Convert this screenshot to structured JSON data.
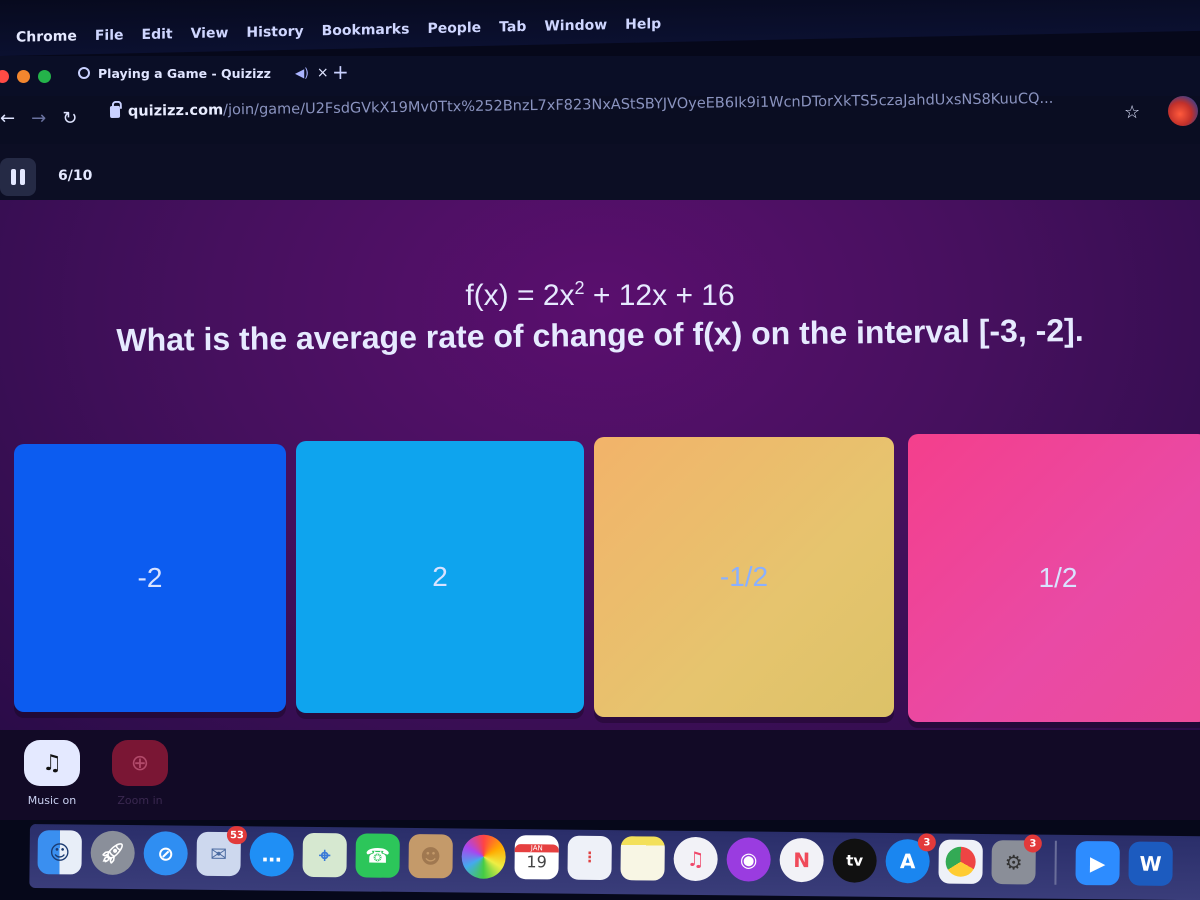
{
  "menubar": {
    "app_name": "Chrome",
    "items": [
      "File",
      "Edit",
      "View",
      "History",
      "Bookmarks",
      "People",
      "Tab",
      "Window",
      "Help"
    ]
  },
  "browser": {
    "tab": {
      "title": "Playing a Game - Quizizz",
      "audio_icon": "speaker-icon",
      "close_label": "×"
    },
    "new_tab_label": "+",
    "url_host": "quizizz.com",
    "url_path": "/join/game/U2FsdGVkX19Mv0Ttx%252BnzL7xF823NxAStSBYJVOyeEB6Ik9i1WcnDTorXkTS5czaJahdUxsNS8KuuCQ...",
    "colors": {
      "close": "#ff5f57",
      "minimize": "#febc2e",
      "zoom": "#28c840"
    }
  },
  "quiz": {
    "progress": "6/10",
    "question": {
      "formula_prefix": "f(x) = 2x",
      "formula_exp": "2",
      "formula_suffix": " + 12x + 16",
      "prompt": "What is the average rate of change of f(x) on the interval [-3, -2]."
    },
    "options": [
      {
        "label": "-2",
        "color": "#0c5cf0"
      },
      {
        "label": "2",
        "color": "#0ea4ee"
      },
      {
        "label": "-1/2",
        "color": "#f2b36a"
      },
      {
        "label": "1/2",
        "color": "#f43f8c"
      }
    ],
    "controls": {
      "music_label": "Music on",
      "zoom_label": "Zoom in"
    }
  },
  "dock": {
    "items": [
      {
        "name": "Finder"
      },
      {
        "name": "Launchpad"
      },
      {
        "name": "Safari"
      },
      {
        "name": "Mail",
        "badge": "53"
      },
      {
        "name": "Messages"
      },
      {
        "name": "Maps"
      },
      {
        "name": "FaceTime"
      },
      {
        "name": "Contacts"
      },
      {
        "name": "Photos"
      },
      {
        "name": "Calendar",
        "month": "JAN",
        "day": "19"
      },
      {
        "name": "Reminders"
      },
      {
        "name": "Notes"
      },
      {
        "name": "Music"
      },
      {
        "name": "Podcasts"
      },
      {
        "name": "News"
      },
      {
        "name": "TV",
        "label": "tv"
      },
      {
        "name": "App Store",
        "badge": "3"
      },
      {
        "name": "Chrome"
      },
      {
        "name": "System Preferences",
        "badge": "3"
      },
      {
        "name": "Zoom"
      },
      {
        "name": "Word",
        "label": "W"
      }
    ]
  }
}
